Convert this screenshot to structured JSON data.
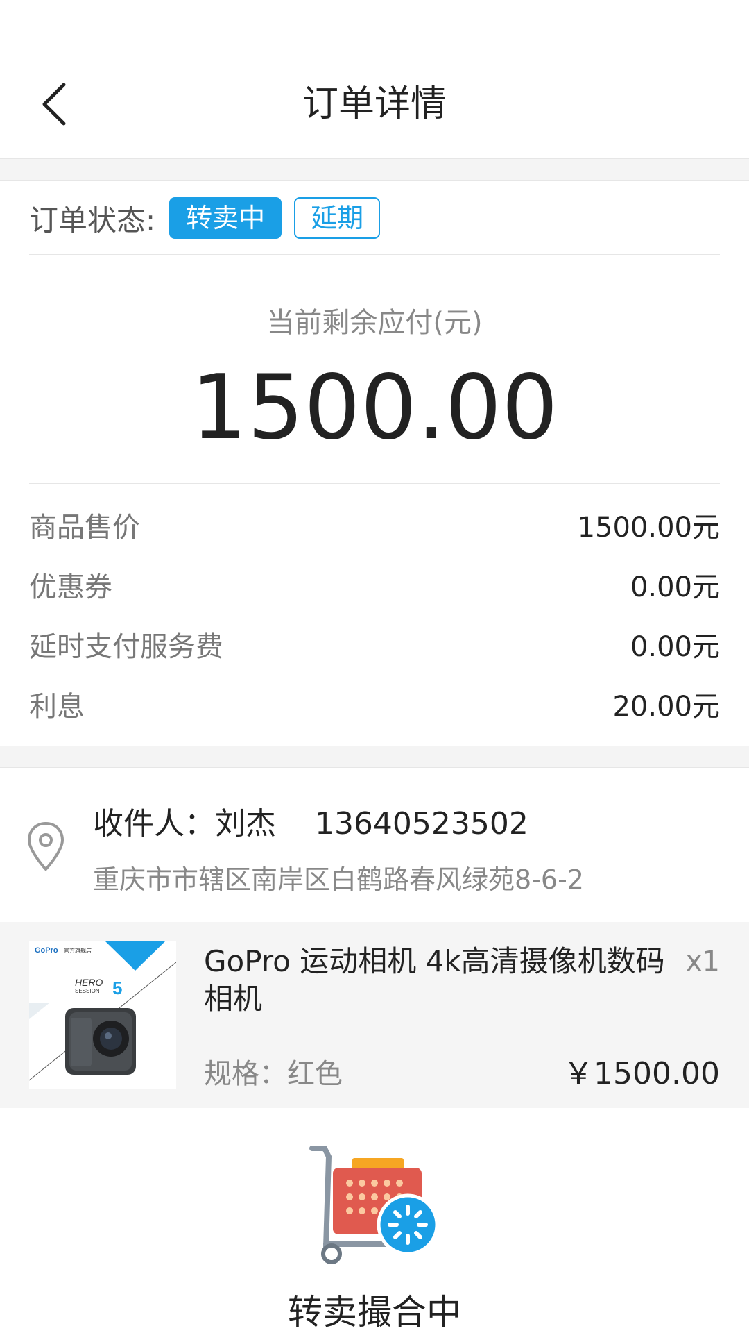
{
  "header": {
    "title": "订单详情",
    "back_icon": "chevron-left-icon"
  },
  "status": {
    "label": "订单状态:",
    "badge_primary": "转卖中",
    "badge_secondary": "延期"
  },
  "remaining": {
    "label": "当前剩余应付(元)",
    "amount": "1500.00"
  },
  "fees": [
    {
      "label": "商品售价",
      "value": "1500.00元"
    },
    {
      "label": "优惠券",
      "value": "0.00元"
    },
    {
      "label": "延时支付服务费",
      "value": "0.00元"
    },
    {
      "label": "利息",
      "value": "20.00元"
    }
  ],
  "address": {
    "icon": "location-pin-icon",
    "recipient": "收件人：刘杰    13640523502",
    "detail": "重庆市市辖区南岸区白鹤路春风绿苑8-6-2"
  },
  "product": {
    "name": "GoPro 运动相机 4k高清摄像机数码相机",
    "qty": "x1",
    "spec": "规格：红色",
    "price": "￥1500.00",
    "image_brand": "GoPro",
    "image_store": "官方旗舰店",
    "image_model": "HERO",
    "image_sub": "SESSION",
    "image_number": "5"
  },
  "resale": {
    "caption": "转卖撮合中",
    "icon": "shopping-cart-loading-icon"
  },
  "colors": {
    "accent": "#1a9fe6"
  }
}
